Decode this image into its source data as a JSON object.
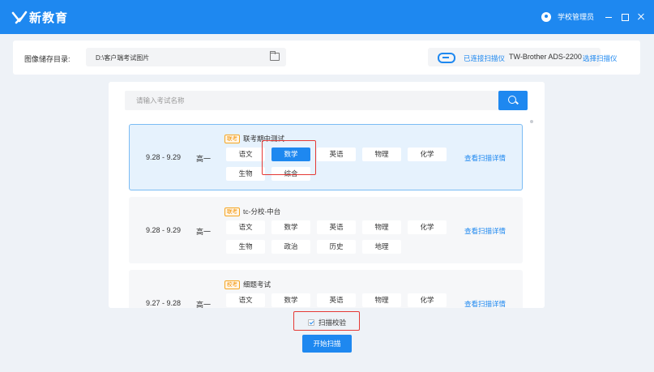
{
  "app": {
    "logo_text": "新教育",
    "user_name": "学校管理员"
  },
  "topbar": {
    "dir_label": "图像储存目录:",
    "dir_value": "D:\\客户端考试图片",
    "scan_status": "已连接扫描仪",
    "scanner_model": "TW-Brother ADS-2200",
    "choose_scanner": "选择扫描仪"
  },
  "search": {
    "placeholder": "请输入考试名称"
  },
  "exams": [
    {
      "badge": "联考",
      "name": "联考期中测试",
      "date": "9.28 - 9.29",
      "grade": "高一",
      "subjects": [
        "语文",
        "数学",
        "英语",
        "物理",
        "化学",
        "生物",
        "综合"
      ],
      "active_subject": "数学",
      "details_label": "查看扫描详情"
    },
    {
      "badge": "联考",
      "name": "tc-分校-中台",
      "date": "9.28 - 9.29",
      "grade": "高一",
      "subjects": [
        "语文",
        "数学",
        "英语",
        "物理",
        "化学",
        "生物",
        "政治",
        "历史",
        "地理"
      ],
      "details_label": "查看扫描详情"
    },
    {
      "badge": "校考",
      "name": "细题考试",
      "date": "9.27 - 9.28",
      "grade": "高一",
      "subjects": [
        "语文",
        "数学",
        "英语",
        "物理",
        "化学"
      ],
      "details_label": "查看扫描详情"
    }
  ],
  "footer": {
    "verify_label": "扫描校验",
    "verify_checked": true,
    "start_label": "开始扫描"
  },
  "colors": {
    "brand": "#1e88f0",
    "highlight": "#e53935",
    "badge": "#f29100"
  }
}
